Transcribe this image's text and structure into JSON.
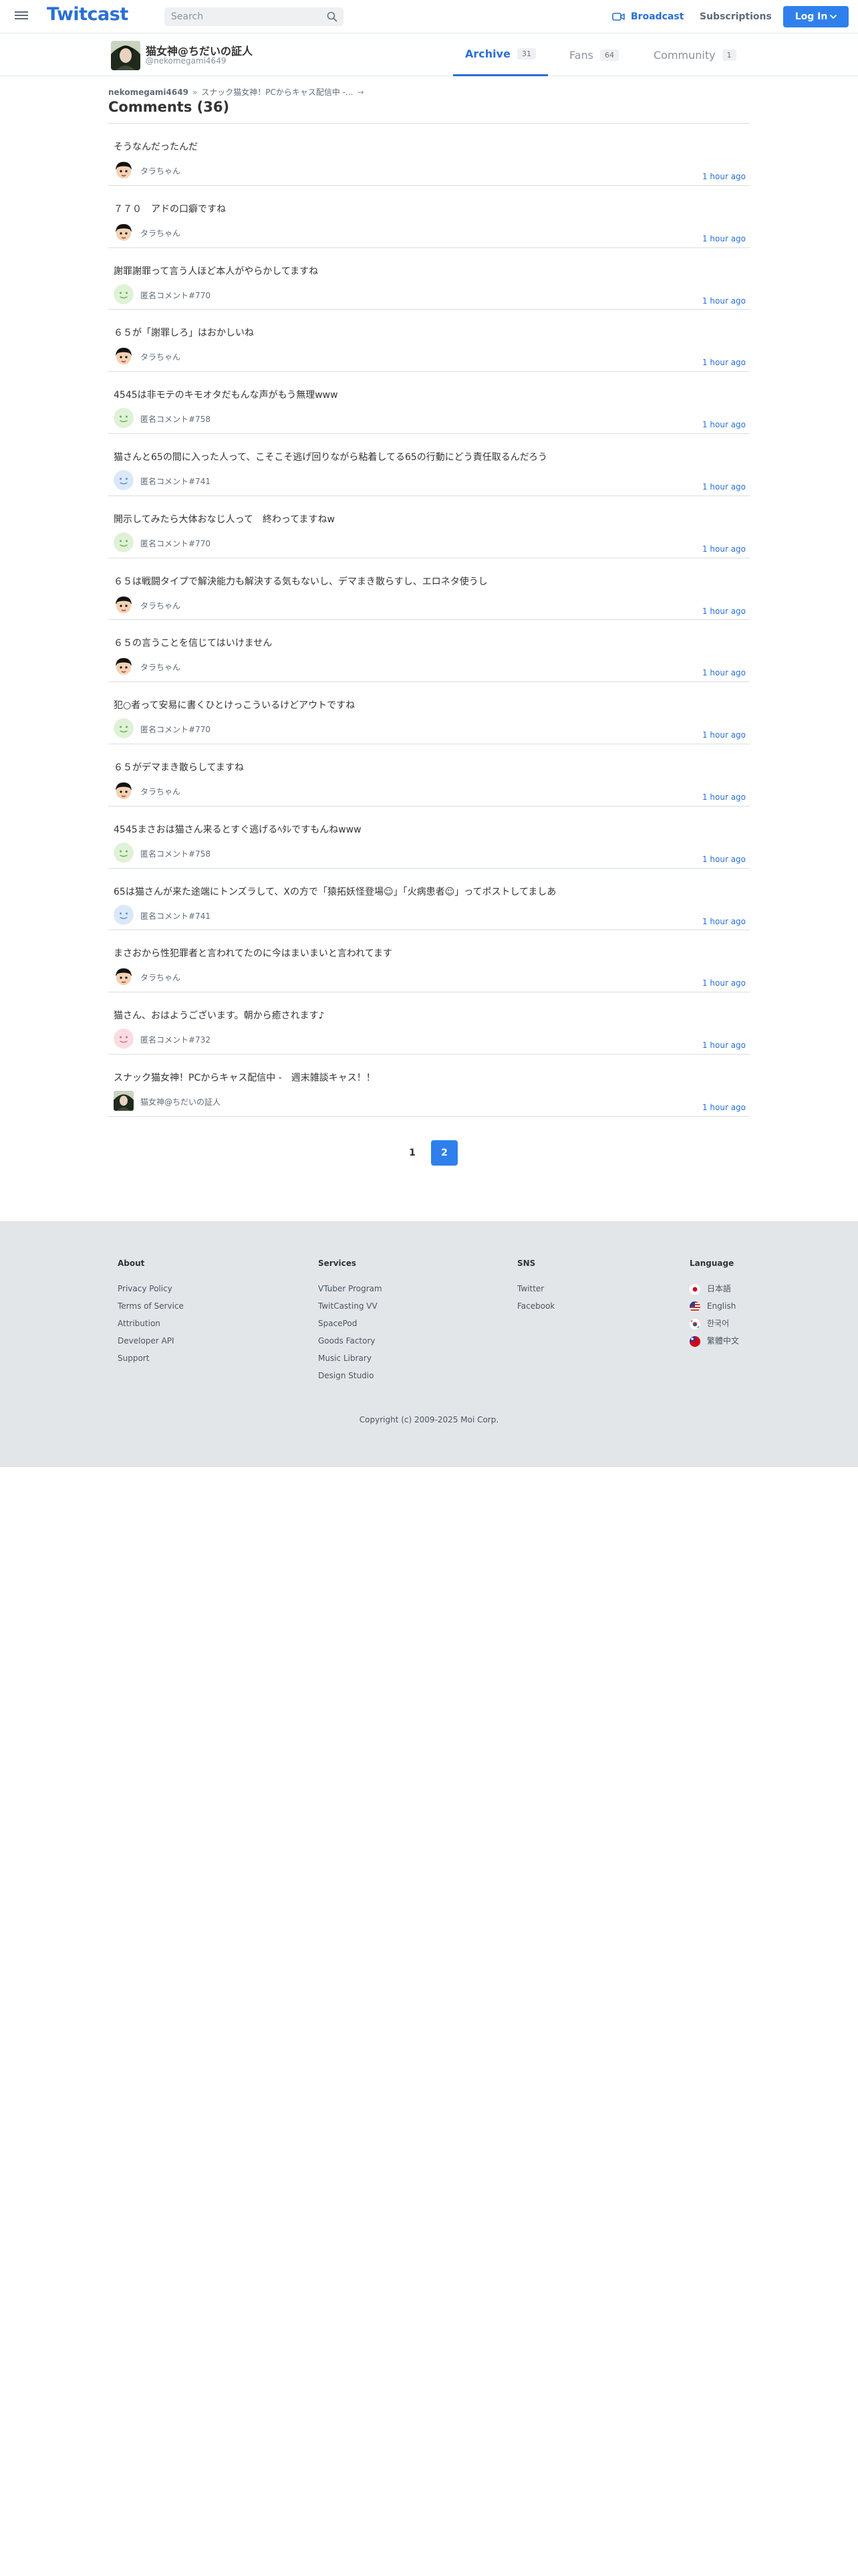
{
  "header": {
    "brand": "Twitcast",
    "search_placeholder": "Search",
    "broadcast_label": "Broadcast",
    "subscriptions_label": "Subscriptions",
    "login_label": "Log In"
  },
  "profile": {
    "name": "猫女神@ちだいの証人",
    "handle": "@nekomegami4649",
    "tabs": [
      {
        "label": "Archive",
        "count": "31",
        "active": true
      },
      {
        "label": "Fans",
        "count": "64",
        "active": false
      },
      {
        "label": "Community",
        "count": "1",
        "active": false
      }
    ]
  },
  "breadcrumb": {
    "user": "nekomegami4649",
    "movie": "スナック猫女神！PCからキャス配信中 -...",
    "arrow": "»",
    "tail_arrow": "→"
  },
  "page_title": "Comments (36)",
  "comments": [
    {
      "text": "そうなんだったんだ",
      "user": "タラちゃん",
      "time": "1 hour ago",
      "avatar": "tara"
    },
    {
      "text": "７７０　アドの口癖ですね",
      "user": "タラちゃん",
      "time": "1 hour ago",
      "avatar": "tara"
    },
    {
      "text": "謝罪謝罪って言う人ほど本人がやらかしてますね",
      "user": "匿名コメント#770",
      "time": "1 hour ago",
      "avatar": "green"
    },
    {
      "text": "６５が「謝罪しろ」はおかしいね",
      "user": "タラちゃん",
      "time": "1 hour ago",
      "avatar": "tara"
    },
    {
      "text": "4545は非モテのキモオタだもんな声がもう無理www",
      "user": "匿名コメント#758",
      "time": "1 hour ago",
      "avatar": "green"
    },
    {
      "text": "猫さんと65の間に入った人って、こそこそ逃げ回りながら粘着してる65の行動にどう責任取るんだろう",
      "user": "匿名コメント#741",
      "time": "1 hour ago",
      "avatar": "blue"
    },
    {
      "text": "開示してみたら大体おなじ人って　終わってますねw",
      "user": "匿名コメント#770",
      "time": "1 hour ago",
      "avatar": "green"
    },
    {
      "text": "６５は戦闘タイプで解決能力も解決する気もないし、デマまき散らすし、エロネタ使うし",
      "user": "タラちゃん",
      "time": "1 hour ago",
      "avatar": "tara"
    },
    {
      "text": "６５の言うことを信じてはいけません",
      "user": "タラちゃん",
      "time": "1 hour ago",
      "avatar": "tara"
    },
    {
      "text": "犯○者って安易に書くひとけっこういるけどアウトですね",
      "user": "匿名コメント#770",
      "time": "1 hour ago",
      "avatar": "green"
    },
    {
      "text": "６５がデマまき散らしてますね",
      "user": "タラちゃん",
      "time": "1 hour ago",
      "avatar": "tara"
    },
    {
      "text": "4545まさおは猫さん来るとすぐ逃げるﾍﾀﾚですもんねwww",
      "user": "匿名コメント#758",
      "time": "1 hour ago",
      "avatar": "green"
    },
    {
      "text": "65は猫さんが来た途端にトンズラして、Xの方で「猿拓妖怪登場☺」「火病患者☺」ってポストしてましあ",
      "user": "匿名コメント#741",
      "time": "1 hour ago",
      "avatar": "blue"
    },
    {
      "text": "まさおから性犯罪者と言われてたのに今はまいまいと言われてます",
      "user": "タラちゃん",
      "time": "1 hour ago",
      "avatar": "tara"
    },
    {
      "text": "猫さん、おはようございます。朝から癒されます♪",
      "user": "匿名コメント#732",
      "time": "1 hour ago",
      "avatar": "pink"
    },
    {
      "text": "スナック猫女神！PCからキャス配信中 -　週末雑談キャス！！",
      "user": "猫女神@ちだいの証人",
      "time": "1 hour ago",
      "avatar": "owner"
    }
  ],
  "pagination": {
    "pages": [
      "1",
      "2"
    ],
    "current": "2"
  },
  "footer": {
    "columns": [
      {
        "heading": "About",
        "links": [
          "Privacy Policy",
          "Terms of Service",
          "Attribution",
          "Developer API",
          "Support"
        ]
      },
      {
        "heading": "Services",
        "links": [
          "VTuber Program",
          "TwitCasting VV",
          "SpacePod",
          "Goods Factory",
          "Music Library",
          "Design Studio"
        ]
      },
      {
        "heading": "SNS",
        "links": [
          "Twitter",
          "Facebook"
        ]
      },
      {
        "heading": "Language",
        "links": [
          "日本語",
          "English",
          "한국어",
          "繁體中文"
        ]
      }
    ],
    "copyright": "Copyright (c) 2009-2025 Moi Corp."
  },
  "colors": {
    "accent": "#2f80ed",
    "link": "#2a6fd6",
    "footer_bg": "#e3e6e9"
  },
  "icons": {
    "menu": "hamburger-icon",
    "search": "search-icon",
    "broadcast": "video-camera-icon",
    "login_caret": "chevron-down-icon"
  }
}
